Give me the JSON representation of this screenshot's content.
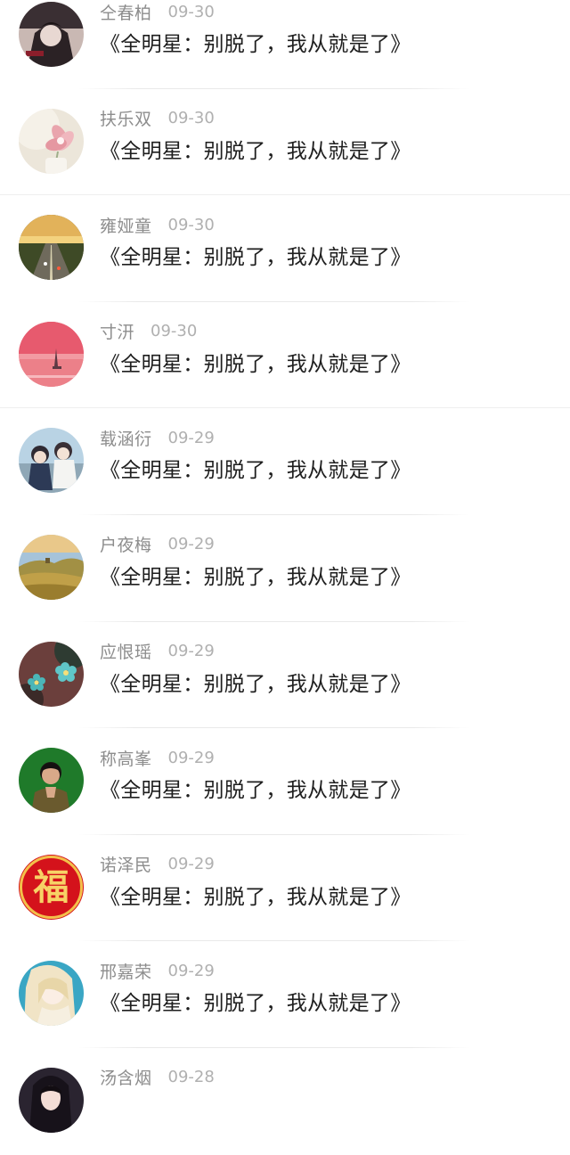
{
  "comments": [
    {
      "username": "仝春柏",
      "date": "09-30",
      "title": "《全明星：别脱了，我从就是了》",
      "avatar": "avatar-anime-dark-icon"
    },
    {
      "username": "扶乐双",
      "date": "09-30",
      "title": "《全明星：别脱了，我从就是了》",
      "avatar": "avatar-flower-icon"
    },
    {
      "username": "雍娅童",
      "date": "09-30",
      "title": "《全明星：别脱了，我从就是了》",
      "avatar": "avatar-road-sunset-icon"
    },
    {
      "username": "寸汧",
      "date": "09-30",
      "title": "《全明星：别脱了，我从就是了》",
      "avatar": "avatar-pink-sea-icon"
    },
    {
      "username": "载涵衍",
      "date": "09-29",
      "title": "《全明星：别脱了，我从就是了》",
      "avatar": "avatar-anime-couple-icon"
    },
    {
      "username": "户夜梅",
      "date": "09-29",
      "title": "《全明星：别脱了，我从就是了》",
      "avatar": "avatar-landscape-icon"
    },
    {
      "username": "应恨瑶",
      "date": "09-29",
      "title": "《全明星：别脱了，我从就是了》",
      "avatar": "avatar-forget-me-not-icon"
    },
    {
      "username": "称高峯",
      "date": "09-29",
      "title": "《全明星：别脱了，我从就是了》",
      "avatar": "avatar-man-portrait-icon"
    },
    {
      "username": "诺泽民",
      "date": "09-29",
      "title": "《全明星：别脱了，我从就是了》",
      "avatar": "avatar-fu-character-icon"
    },
    {
      "username": "邢嘉荣",
      "date": "09-29",
      "title": "《全明星：别脱了，我从就是了》",
      "avatar": "avatar-anime-blonde-icon"
    },
    {
      "username": "汤含烟",
      "date": "09-28",
      "title": "",
      "avatar": "avatar-girl-portrait-icon"
    }
  ],
  "avatar_fu_character": "福"
}
